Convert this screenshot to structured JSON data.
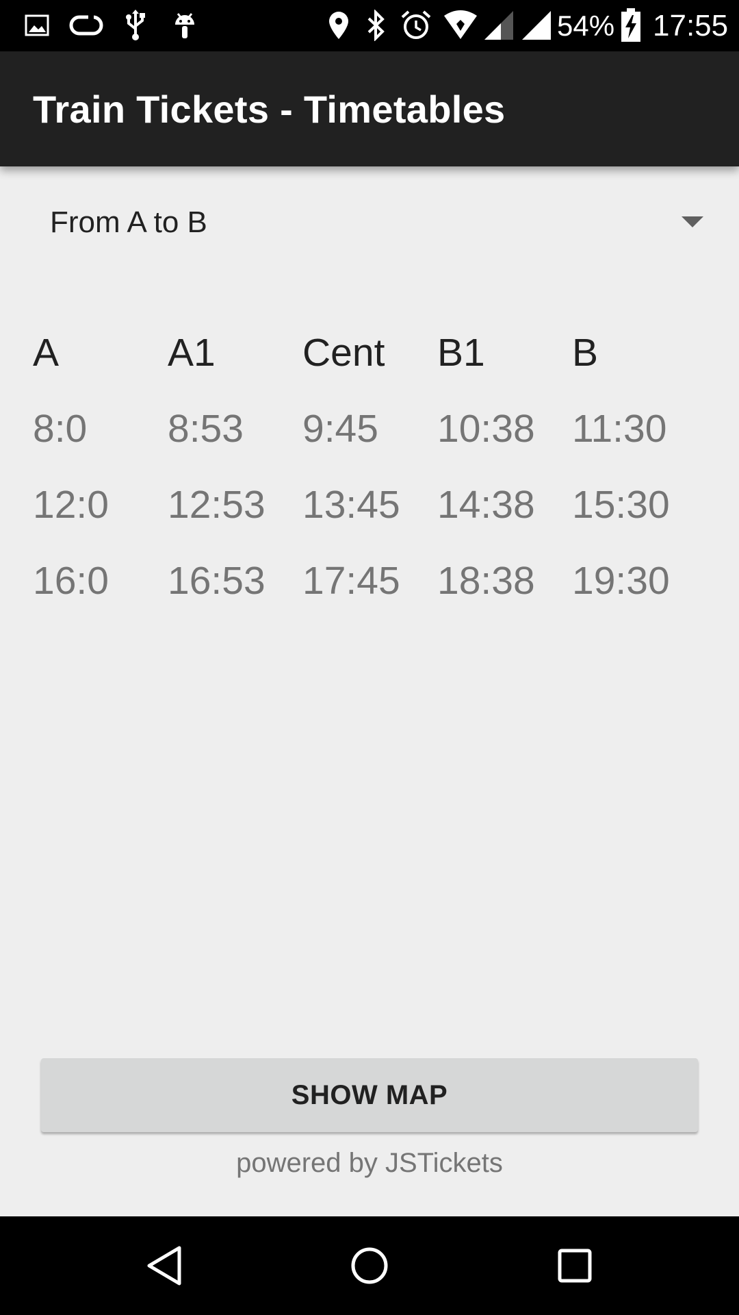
{
  "status_bar": {
    "left_icons": [
      "image-icon",
      "sync-loop-icon",
      "usb-icon",
      "android-icon"
    ],
    "right_icons": [
      "location-pin-icon",
      "bluetooth-icon",
      "alarm-icon",
      "wifi-icon",
      "signal-icon",
      "battery-charging-icon"
    ],
    "battery_percent": "54%",
    "time": "17:55"
  },
  "app_bar": {
    "title": "Train Tickets - Timetables"
  },
  "route_spinner": {
    "selected": "From A to B"
  },
  "timetable": {
    "headers": [
      "A",
      "A1",
      "Cent",
      "B1",
      "B"
    ],
    "rows": [
      [
        "8:0",
        "8:53",
        "9:45",
        "10:38",
        "11:30"
      ],
      [
        "12:0",
        "12:53",
        "13:45",
        "14:38",
        "15:30"
      ],
      [
        "16:0",
        "16:53",
        "17:45",
        "18:38",
        "19:30"
      ]
    ]
  },
  "show_map_label": "SHOW MAP",
  "footer": "powered by JSTickets",
  "nav_bar": {
    "buttons": [
      "back-icon",
      "home-icon",
      "recents-icon"
    ]
  }
}
